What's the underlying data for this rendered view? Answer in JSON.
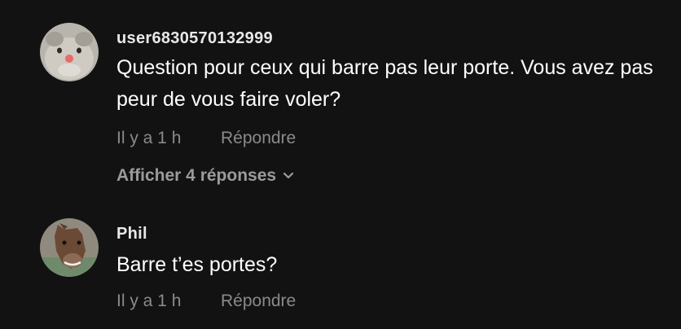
{
  "comments": [
    {
      "username": "user6830570132999",
      "text": "Question pour ceux qui barre pas leur porte. Vous avez pas peur de vous faire voler?",
      "time": "Il y a 1 h",
      "reply_label": "Répondre",
      "view_replies_label": "Afficher 4 réponses"
    },
    {
      "username": "Phil",
      "text": "Barre t’es portes?",
      "time": "Il y a 1 h",
      "reply_label": "Répondre"
    }
  ],
  "colors": {
    "background": "#121212",
    "text": "#ffffff",
    "secondary": "#8a8a8a"
  }
}
